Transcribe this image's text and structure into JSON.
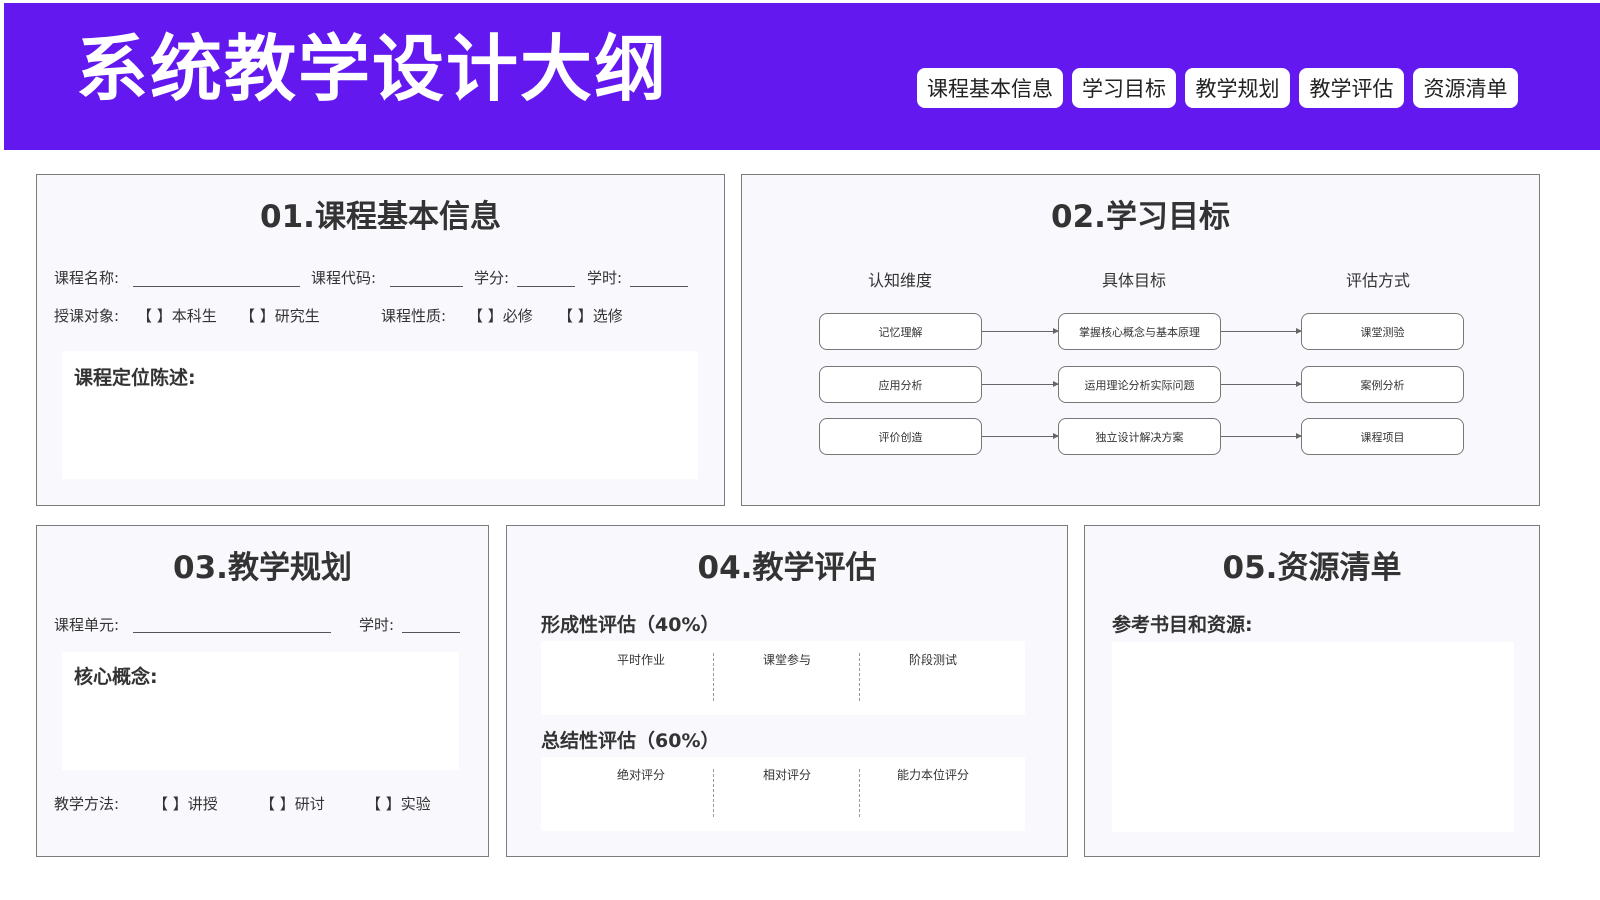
{
  "header": {
    "title": "系统教学设计大纲",
    "nav": [
      "课程基本信息",
      "学习目标",
      "教学规划",
      "教学评估",
      "资源清单"
    ]
  },
  "basic": {
    "title": "01.课程基本信息",
    "course_name": "课程名称:",
    "course_code": "课程代码:",
    "credit": "学分:",
    "hours": "学时:",
    "audience": "授课对象:",
    "opt_undergrad": "【 】本科生",
    "opt_grad": "【 】研究生",
    "nature": "课程性质:",
    "opt_required": "【 】必修",
    "opt_elective": "【 】选修",
    "positioning": "课程定位陈述:"
  },
  "objectives": {
    "title": "02.学习目标",
    "headers": [
      "认知维度",
      "具体目标",
      "评估方式"
    ],
    "rows": [
      [
        "记忆理解",
        "掌握核心概念与基本原理",
        "课堂测验"
      ],
      [
        "应用分析",
        "运用理论分析实际问题",
        "案例分析"
      ],
      [
        "评价创造",
        "独立设计解决方案",
        "课程项目"
      ]
    ]
  },
  "planning": {
    "title": "03.教学规划",
    "unit": "课程单元:",
    "hours": "学时:",
    "core": "核心概念:",
    "method": "教学方法:",
    "opt_lecture": "【 】讲授",
    "opt_discussion": "【 】研讨",
    "opt_experiment": "【 】实验"
  },
  "assessment": {
    "title": "04.教学评估",
    "formative": {
      "label": "形成性评估（40%）",
      "items": [
        "平时作业",
        "课堂参与",
        "阶段测试"
      ]
    },
    "summative": {
      "label": "总结性评估（60%）",
      "items": [
        "绝对评分",
        "相对评分",
        "能力本位评分"
      ]
    }
  },
  "resources": {
    "title": "05.资源清单",
    "label": "参考书目和资源:"
  }
}
